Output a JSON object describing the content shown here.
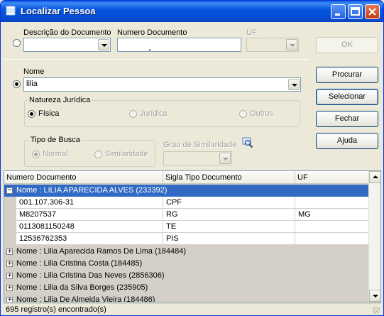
{
  "window": {
    "title": "Localizar Pessoa"
  },
  "search_doc": {
    "desc_label": "Descrição do Documento",
    "desc_value": "",
    "number_label": "Numero Documento",
    "number_value": " .   .   /   -",
    "uf_label": "UF",
    "uf_value": ""
  },
  "name_search": {
    "label": "Nome",
    "value": "lilia"
  },
  "natureza": {
    "legend": "Natureza Jurídica",
    "options": [
      "Física",
      "Jurídica",
      "Outros"
    ],
    "selected": "Física"
  },
  "tipo_busca": {
    "legend": "Tipo de Busca",
    "options": [
      "Normal",
      "Similaridade"
    ],
    "selected": "Normal"
  },
  "grau": {
    "label": "Grau de Similaridade",
    "value": ""
  },
  "buttons": {
    "ok": "OK",
    "procurar": "Procurar",
    "selecionar": "Selecionar",
    "fechar": "Fechar",
    "ajuda": "Ajuda"
  },
  "grid": {
    "columns": [
      "Numero Documento",
      "Sigla Tipo Documento",
      "UF"
    ],
    "expanded_group": {
      "label": "Nome : LILIA APARECIDA ALVES (233392)",
      "rows": [
        [
          "001.107.306-31",
          "CPF",
          ""
        ],
        [
          "M8207537",
          "RG",
          "MG"
        ],
        [
          "0113081150248",
          "TE",
          ""
        ],
        [
          "12536762353",
          "PIS",
          ""
        ]
      ]
    },
    "collapsed_groups": [
      "Nome : Lilia Aparecida Ramos De Lima (184484)",
      "Nome : Lilia Cristina Costa (184485)",
      "Nome : Lilia Cristina Das Neves (2856306)",
      "Nome : Lilia da Silva Borges (235905)",
      "Nome : Lilia De Almeida Vieira (184486)"
    ]
  },
  "status": {
    "text": "695 registro(s) encontrado(s)"
  },
  "colors": {
    "titlebar": "#0856e0",
    "selection": "#316ac5",
    "face": "#ece9d8"
  }
}
